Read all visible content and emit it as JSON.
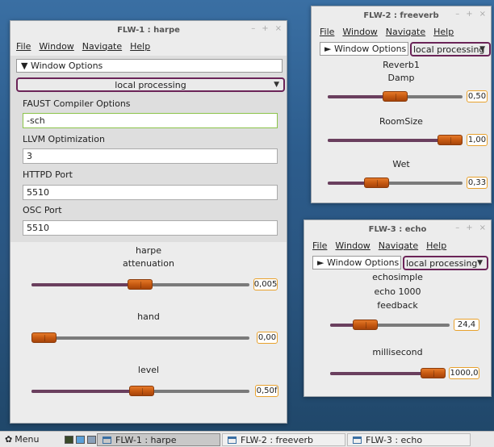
{
  "menu_items": [
    "File",
    "Window",
    "Navigate",
    "Help"
  ],
  "window_buttons": [
    "–",
    "+",
    "×"
  ],
  "flw1": {
    "title": "FLW-1 : harpe",
    "window_options": "▼ Window Options",
    "dropdown": "local processing",
    "faust_label": "FAUST Compiler Options",
    "faust_value": "-sch",
    "llvm_label": "LLVM Optimization",
    "llvm_value": "3",
    "httpd_label": "HTTPD Port",
    "httpd_value": "5510",
    "osc_label": "OSC Port",
    "osc_value": "5510",
    "group": "harpe",
    "sliders": [
      {
        "name": "attenuation",
        "value": "0,005",
        "level": 0.5
      },
      {
        "name": "hand",
        "value": "0,00",
        "level": 0.0
      },
      {
        "name": "level",
        "value": "0,50f",
        "level": 0.5
      }
    ]
  },
  "flw2": {
    "title": "FLW-2 : freeverb",
    "window_options": "► Window Options",
    "dropdown": "local processing",
    "group": "Reverb1",
    "sliders": [
      {
        "name": "Damp",
        "value": "0,50",
        "level": 0.5
      },
      {
        "name": "RoomSize",
        "value": "1,00",
        "level": 1.0
      },
      {
        "name": "Wet",
        "value": "0,33",
        "level": 0.33
      }
    ]
  },
  "flw3": {
    "title": "FLW-3 : echo",
    "window_options": "► Window Options",
    "dropdown": "local processing",
    "group": "echosimple",
    "subgroup": "echo  1000",
    "sliders": [
      {
        "name": "feedback",
        "value": "24,4",
        "level": 0.24
      },
      {
        "name": "millisecond",
        "value": "1000,0",
        "level": 1.0
      }
    ]
  },
  "taskbar": {
    "menu_label": "Menu",
    "tasks": [
      "FLW-1 : harpe",
      "FLW-2 : freeverb",
      "FLW-3 : echo"
    ]
  }
}
